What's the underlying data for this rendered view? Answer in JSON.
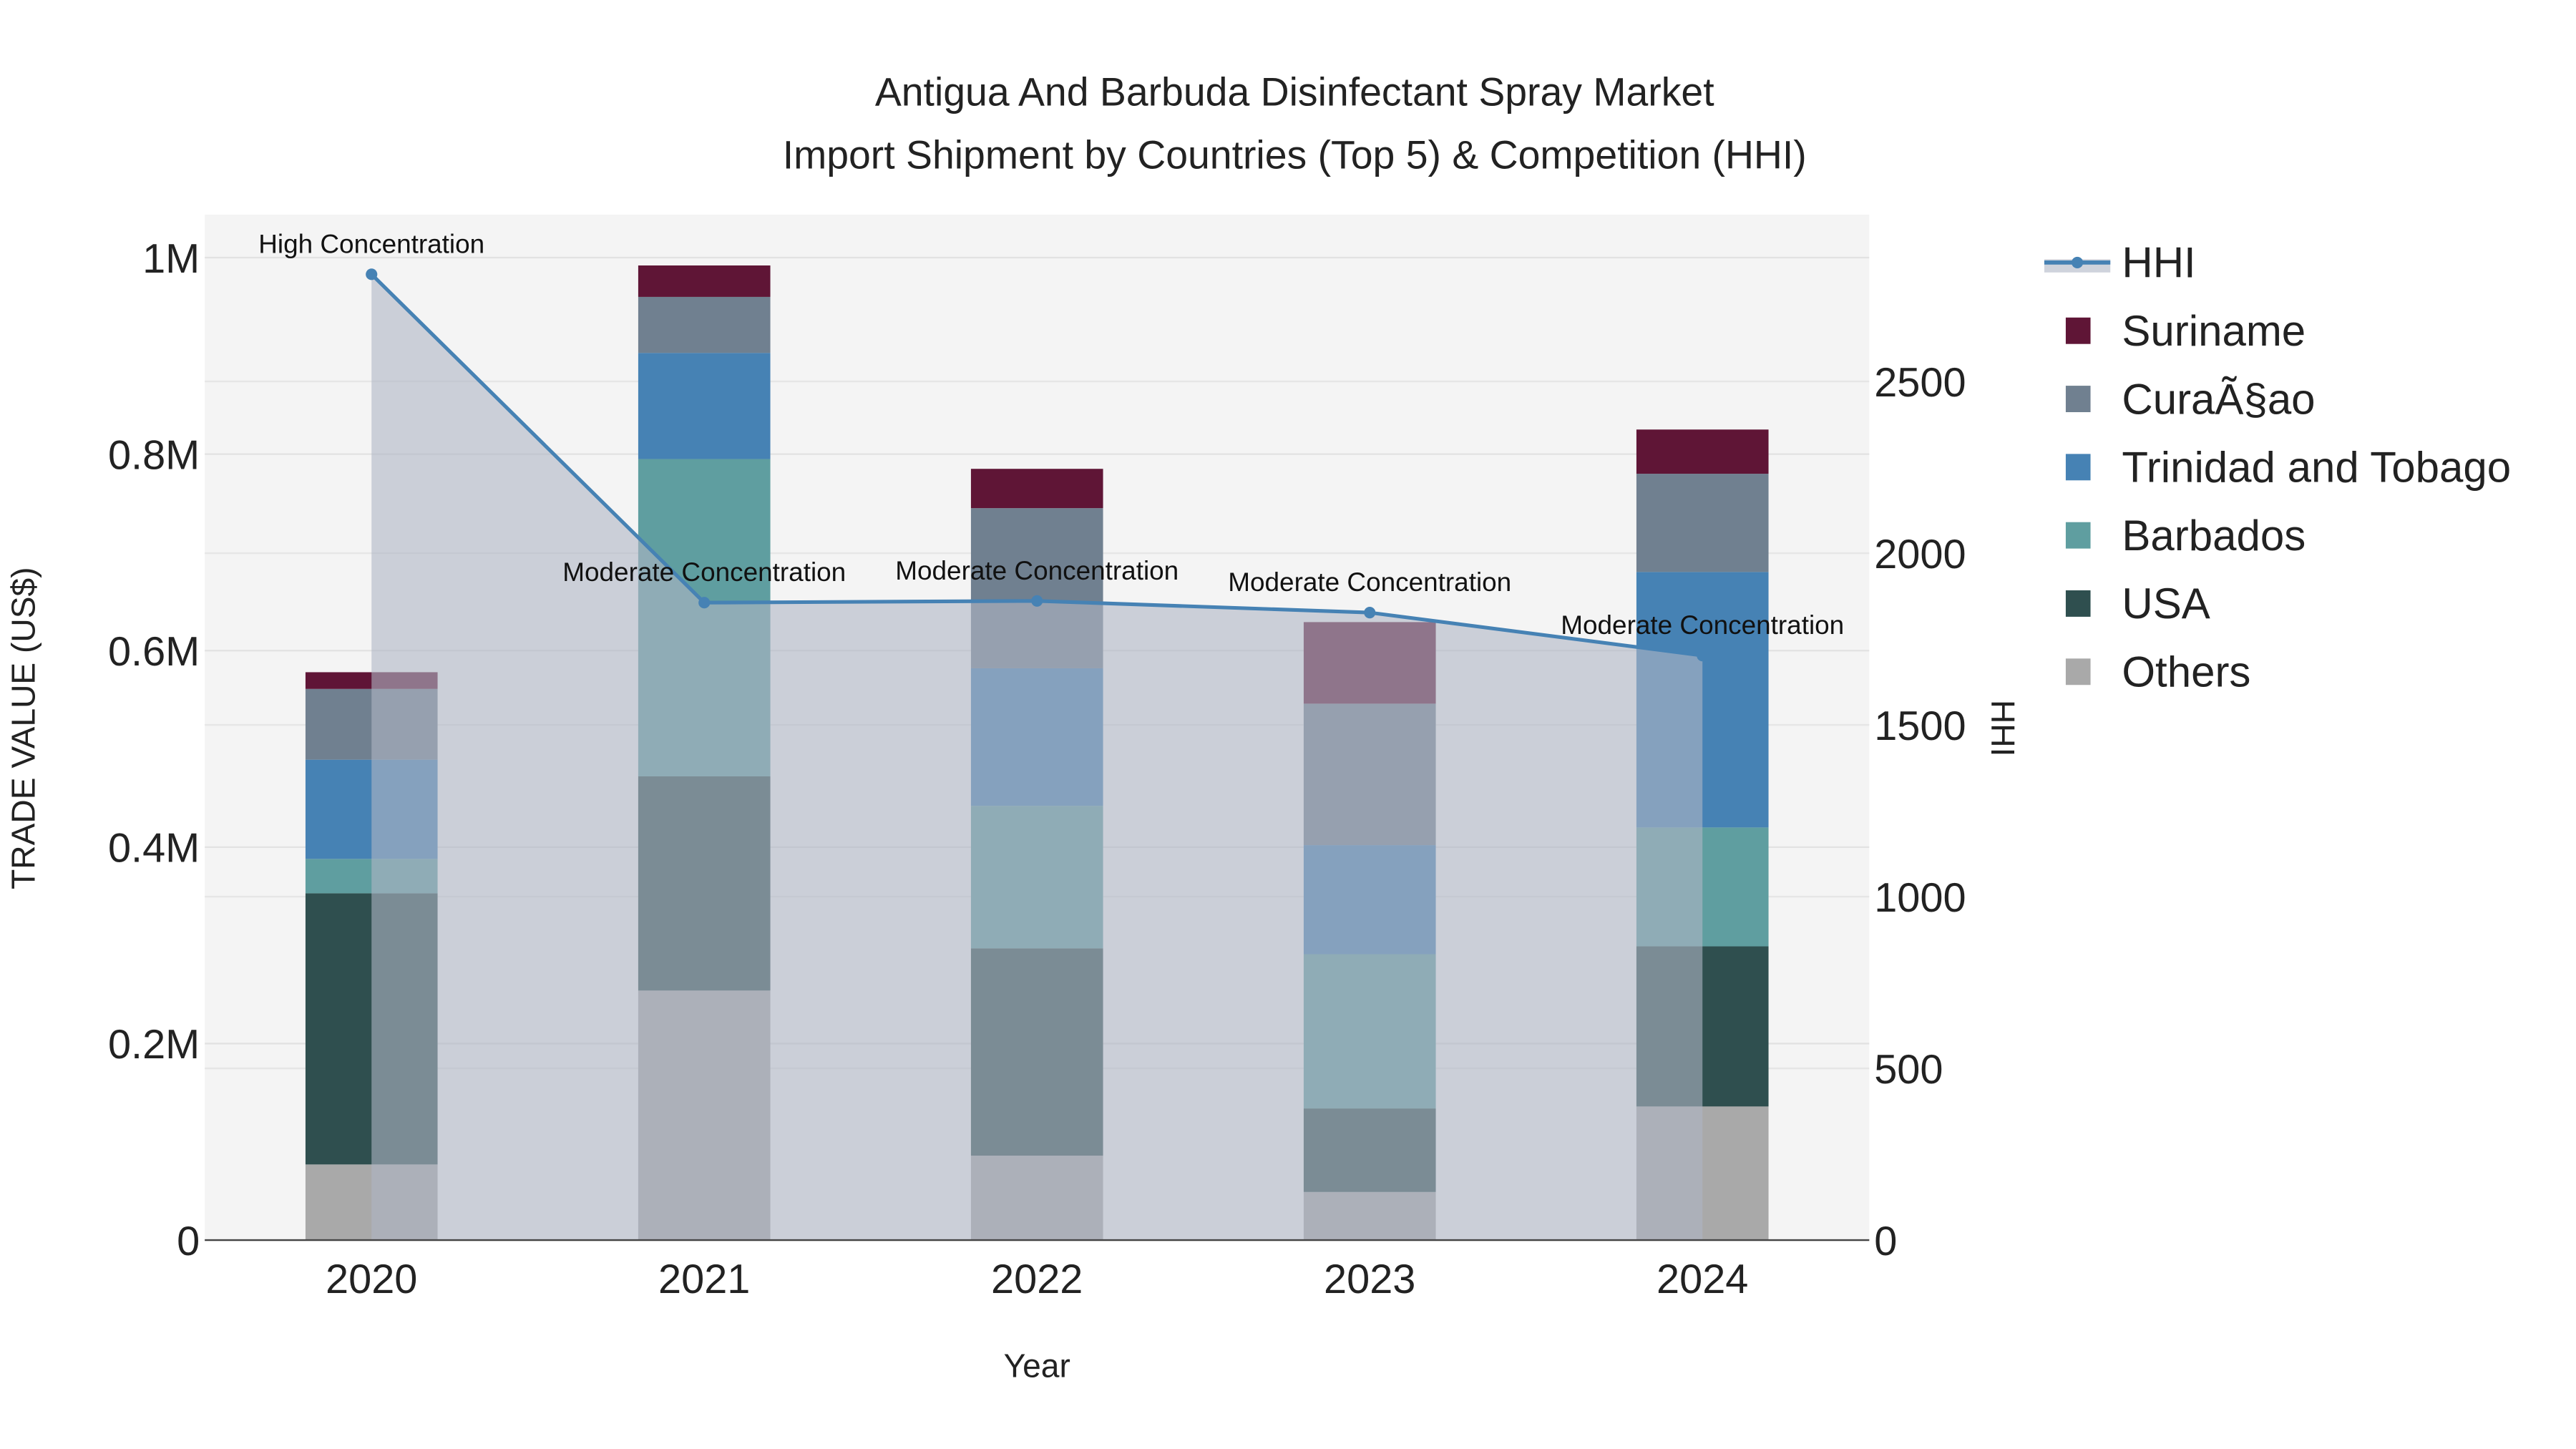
{
  "chart_data": {
    "type": "bar",
    "stacked": true,
    "title_line1": "Antigua And Barbuda Disinfectant Spray Market",
    "title_line2": "Import Shipment by Countries (Top 5) & Competition (HHI)",
    "xlabel": "Year",
    "ylabel": "TRADE VALUE (US$)",
    "y2label": "HHI",
    "categories": [
      "2020",
      "2021",
      "2022",
      "2023",
      "2024"
    ],
    "ylim": [
      0,
      1040000
    ],
    "y_ticks": [
      0,
      200000,
      400000,
      600000,
      800000,
      1000000
    ],
    "y_tick_labels": [
      "0",
      "0.2M",
      "0.4M",
      "0.6M",
      "0.8M",
      "1M"
    ],
    "y2lim": [
      0,
      2970
    ],
    "y2_ticks": [
      0,
      500,
      1000,
      1500,
      2000,
      2500
    ],
    "y2_tick_labels": [
      "0",
      "500",
      "1000",
      "1500",
      "2000",
      "2500"
    ],
    "grid": true,
    "legend_placement": "right",
    "series": [
      {
        "name": "Others",
        "color": "#a9a9a9",
        "values": [
          77000,
          254000,
          86000,
          49000,
          136000
        ]
      },
      {
        "name": "USA",
        "color": "#2f4f4f",
        "values": [
          276000,
          218000,
          211000,
          85000,
          163000
        ]
      },
      {
        "name": "Barbados",
        "color": "#5f9ea0",
        "values": [
          35000,
          323000,
          145000,
          157000,
          121000
        ]
      },
      {
        "name": "Trinidad and Tobago",
        "color": "#4682b4",
        "values": [
          101000,
          108000,
          140000,
          111000,
          260000
        ]
      },
      {
        "name": "CuraÃ§ao",
        "color": "#708090",
        "values": [
          72000,
          57000,
          163000,
          144000,
          100000
        ]
      },
      {
        "name": "Suriname",
        "color": "#5f1536",
        "values": [
          17000,
          32000,
          40000,
          83000,
          45000
        ]
      }
    ],
    "hhi": {
      "name": "HHI",
      "color": "#4682b4",
      "values": [
        2812,
        1856,
        1861,
        1827,
        1702
      ],
      "annotations": [
        "High Concentration",
        "Moderate Concentration",
        "Moderate Concentration",
        "Moderate Concentration",
        "Moderate Concentration"
      ]
    },
    "legend_order": [
      "HHI",
      "Suriname",
      "CuraÃ§ao",
      "Trinidad and Tobago",
      "Barbados",
      "USA",
      "Others"
    ]
  }
}
